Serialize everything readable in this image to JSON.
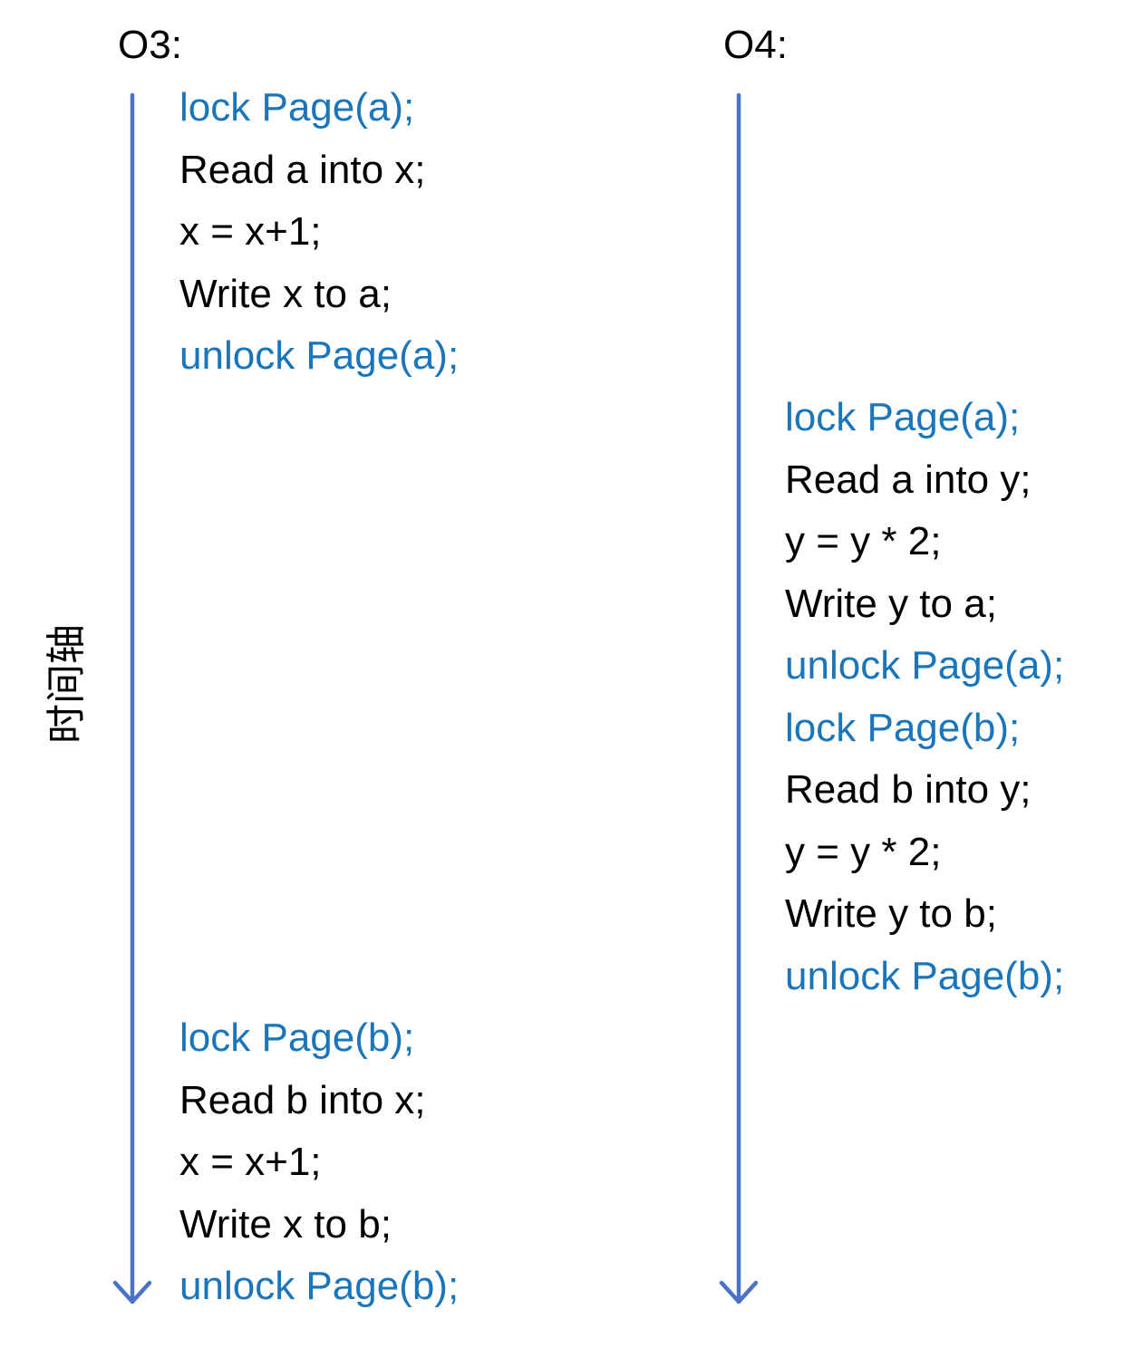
{
  "colors": {
    "axis": "#4a72c7",
    "lock_text": "#1a75bb",
    "plain_text": "#000000"
  },
  "timeline_label": "时间轴",
  "columns": [
    {
      "title": "O3:",
      "blocks": [
        {
          "lines": [
            {
              "text": "lock Page(a);",
              "kind": "lock"
            },
            {
              "text": "Read a into x;",
              "kind": "plain"
            },
            {
              "text": "x = x+1;",
              "kind": "plain"
            },
            {
              "text": "Write x to a;",
              "kind": "plain"
            },
            {
              "text": "unlock Page(a);",
              "kind": "lock"
            }
          ]
        },
        {
          "lines": [
            {
              "text": "lock Page(b);",
              "kind": "lock"
            },
            {
              "text": "Read b into x;",
              "kind": "plain"
            },
            {
              "text": "x = x+1;",
              "kind": "plain"
            },
            {
              "text": "Write x to b;",
              "kind": "plain"
            },
            {
              "text": "unlock Page(b);",
              "kind": "lock"
            }
          ]
        }
      ]
    },
    {
      "title": "O4:",
      "blocks": [
        {
          "lines": [
            {
              "text": "lock Page(a);",
              "kind": "lock"
            },
            {
              "text": "Read a into y;",
              "kind": "plain"
            },
            {
              "text": "y = y * 2;",
              "kind": "plain"
            },
            {
              "text": "Write y to a;",
              "kind": "plain"
            },
            {
              "text": "unlock Page(a);",
              "kind": "lock"
            },
            {
              "text": "lock Page(b);",
              "kind": "lock"
            },
            {
              "text": "Read b into y;",
              "kind": "plain"
            },
            {
              "text": "y = y * 2;",
              "kind": "plain"
            },
            {
              "text": "Write y to b;",
              "kind": "plain"
            },
            {
              "text": "unlock Page(b);",
              "kind": "lock"
            }
          ]
        }
      ]
    }
  ]
}
